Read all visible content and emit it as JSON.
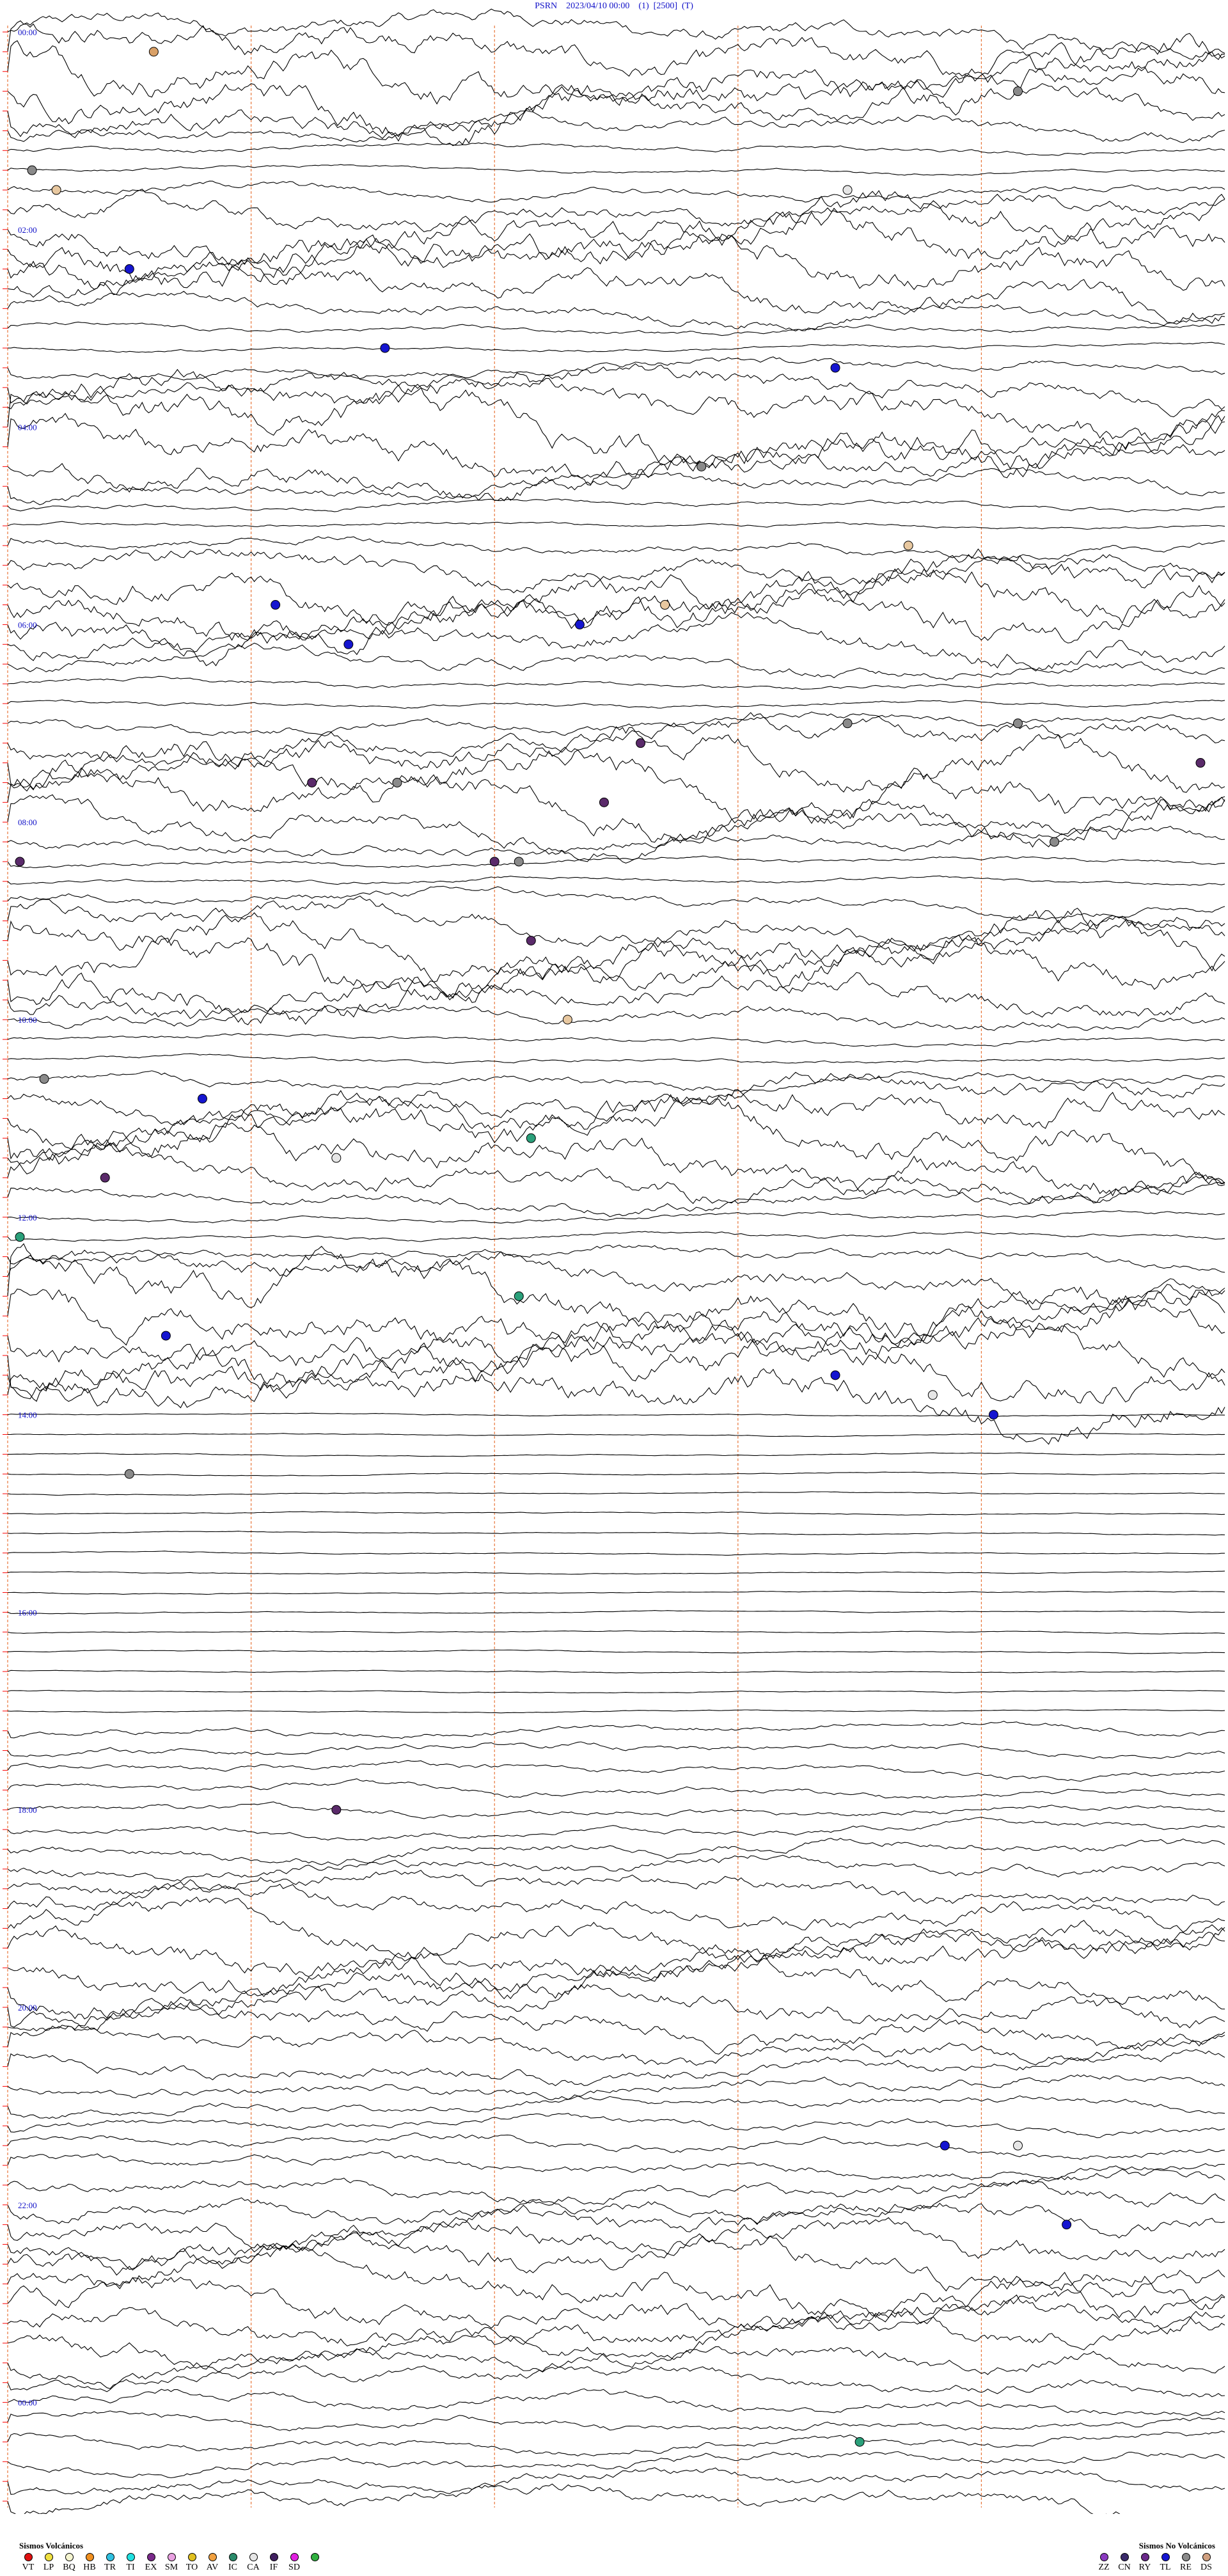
{
  "header": {
    "station": "PSRN",
    "datetime": "2023/04/10 00:00",
    "channel": "(1)",
    "scale": "[2500]",
    "flag": "(T)"
  },
  "chart_data": {
    "type": "helicorder",
    "hour_labels": [
      "00:00",
      "02:00",
      "04:00",
      "06:00",
      "08:00",
      "10:00",
      "12:00",
      "14:00",
      "16:00",
      "18:00",
      "20:00",
      "22:00",
      "00:00"
    ],
    "lines_per_hour": 4,
    "total_lines": 96,
    "minute_marks": 5,
    "colors": {
      "trace": "#000000",
      "label": "#1010c8",
      "marker_line": "#e8763a",
      "start_tick": "#ff0000"
    },
    "events": [
      {
        "color": "#d9a066",
        "line": 1,
        "pos": 0.12
      },
      {
        "color": "#8a8a8a",
        "line": 3,
        "pos": 0.83
      },
      {
        "color": "#8a8a8a",
        "line": 7,
        "pos": 0.02
      },
      {
        "color": "#e8c8a0",
        "line": 8,
        "pos": 0.04
      },
      {
        "color": "#e6e6e6",
        "line": 8,
        "pos": 0.69
      },
      {
        "color": "#1515d0",
        "line": 12,
        "pos": 0.1
      },
      {
        "color": "#1515d0",
        "line": 16,
        "pos": 0.31
      },
      {
        "color": "#1515d0",
        "line": 17,
        "pos": 0.68
      },
      {
        "color": "#8a8a8a",
        "line": 22,
        "pos": 0.57
      },
      {
        "color": "#e8c8a0",
        "line": 26,
        "pos": 0.74
      },
      {
        "color": "#1515d0",
        "line": 29,
        "pos": 0.22
      },
      {
        "color": "#e8c8a0",
        "line": 29,
        "pos": 0.54
      },
      {
        "color": "#1515d0",
        "line": 30,
        "pos": 0.47
      },
      {
        "color": "#1515d0",
        "line": 31,
        "pos": 0.28
      },
      {
        "color": "#8a8a8a",
        "line": 35,
        "pos": 0.69
      },
      {
        "color": "#8a8a8a",
        "line": 35,
        "pos": 0.83
      },
      {
        "color": "#5a2a6a",
        "line": 36,
        "pos": 0.52
      },
      {
        "color": "#5a2a6a",
        "line": 37,
        "pos": 0.98
      },
      {
        "color": "#5a2a6a",
        "line": 38,
        "pos": 0.25
      },
      {
        "color": "#8a8a8a",
        "line": 38,
        "pos": 0.32
      },
      {
        "color": "#5a2a6a",
        "line": 39,
        "pos": 0.49
      },
      {
        "color": "#8a8a8a",
        "line": 41,
        "pos": 0.86
      },
      {
        "color": "#5a2a6a",
        "line": 42,
        "pos": 0.01
      },
      {
        "color": "#5a2a6a",
        "line": 42,
        "pos": 0.4
      },
      {
        "color": "#8a8a8a",
        "line": 42,
        "pos": 0.42
      },
      {
        "color": "#5a2a6a",
        "line": 46,
        "pos": 0.43
      },
      {
        "color": "#e8c8a0",
        "line": 50,
        "pos": 0.46
      },
      {
        "color": "#8a8a8a",
        "line": 53,
        "pos": 0.03
      },
      {
        "color": "#1515d0",
        "line": 54,
        "pos": 0.16
      },
      {
        "color": "#2aa07a",
        "line": 56,
        "pos": 0.43
      },
      {
        "color": "#e6e6e6",
        "line": 57,
        "pos": 0.27
      },
      {
        "color": "#5a2a6a",
        "line": 58,
        "pos": 0.08
      },
      {
        "color": "#2aa07a",
        "line": 61,
        "pos": 0.01
      },
      {
        "color": "#2aa07a",
        "line": 64,
        "pos": 0.42
      },
      {
        "color": "#1515d0",
        "line": 66,
        "pos": 0.13
      },
      {
        "color": "#1515d0",
        "line": 68,
        "pos": 0.68
      },
      {
        "color": "#e6e6e6",
        "line": 69,
        "pos": 0.76
      },
      {
        "color": "#1515d0",
        "line": 70,
        "pos": 0.81
      },
      {
        "color": "#8a8a8a",
        "line": 73,
        "pos": 0.1
      },
      {
        "color": "#5a2a6a",
        "line": 90,
        "pos": 0.27
      },
      {
        "color": "#1515d0",
        "line": 107,
        "pos": 0.77
      },
      {
        "color": "#e6e6e6",
        "line": 107,
        "pos": 0.83
      },
      {
        "color": "#1515d0",
        "line": 111,
        "pos": 0.87
      },
      {
        "color": "#2aa07a",
        "line": 122,
        "pos": 0.7
      }
    ]
  },
  "legend_volcanic": {
    "title": "Sismos Volcánicos",
    "items": [
      {
        "code": "VT",
        "color": "#e01010"
      },
      {
        "code": "LP",
        "color": "#f0e040"
      },
      {
        "code": "BQ",
        "color": "#f5f5d0"
      },
      {
        "code": "HB",
        "color": "#f09020"
      },
      {
        "code": "TR",
        "color": "#30c0e0"
      },
      {
        "code": "TI",
        "color": "#20e0e0"
      },
      {
        "code": "EX",
        "color": "#7a2a8a"
      },
      {
        "code": "SM",
        "color": "#e8a0e0"
      },
      {
        "code": "TO",
        "color": "#e0c020"
      },
      {
        "code": "AV",
        "color": "#f0a040"
      },
      {
        "code": "IC",
        "color": "#2a8a6a"
      },
      {
        "code": "CA",
        "color": "#e6e6e6"
      },
      {
        "code": "IF",
        "color": "#402060"
      },
      {
        "code": "SD",
        "color": "#e020e0"
      },
      {
        "code": "",
        "color": "#30b040"
      }
    ]
  },
  "legend_nonvolcanic": {
    "title": "Sismos No Volcánicos",
    "items": [
      {
        "code": "ZZ",
        "color": "#8a3ac0"
      },
      {
        "code": "CN",
        "color": "#3a2a6a"
      },
      {
        "code": "RY",
        "color": "#6a2a8a"
      },
      {
        "code": "TL",
        "color": "#1515d0"
      },
      {
        "code": "RE",
        "color": "#8a8a8a"
      },
      {
        "code": "DS",
        "color": "#d0a080"
      }
    ]
  }
}
